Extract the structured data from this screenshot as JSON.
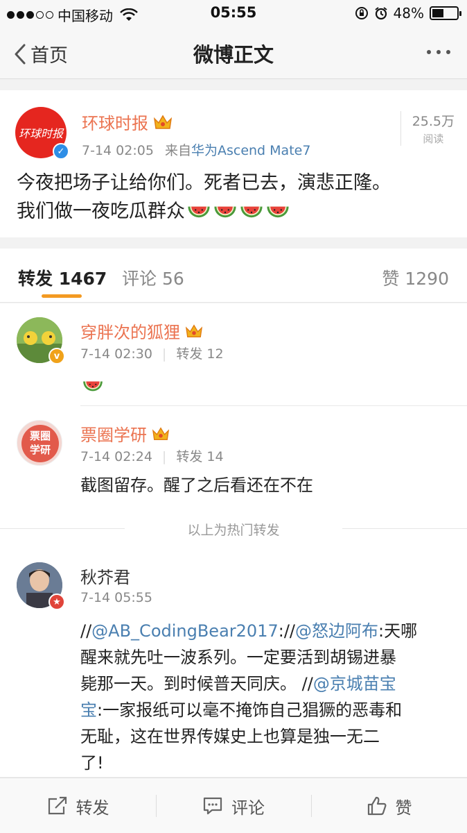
{
  "status": {
    "carrier": "中国移动",
    "time": "05:55",
    "battery": "48%",
    "battery_level": 0.48
  },
  "nav": {
    "back_label": "首页",
    "title": "微博正文"
  },
  "post": {
    "avatar_text": "环球时报",
    "author": "环球时报",
    "time": "7-14 02:05",
    "source_prefix": "来自",
    "source": "华为Ascend Mate7",
    "reads_num": "25.5万",
    "reads_label": "阅读",
    "body_line1": "今夜把场子让给你们。死者已去，演悲正隆。",
    "body_line2": "我们做一夜吃瓜群众"
  },
  "tabs": {
    "repost": "转发 1467",
    "comment": "评论 56",
    "like": "赞 1290"
  },
  "reposts": [
    {
      "name": "穿胖次的狐狸",
      "time": "7-14 02:30",
      "count": "转发 12"
    },
    {
      "name": "票圈学研",
      "avatar_text": "票圈学研",
      "time": "7-14 02:24",
      "count": "转发 14",
      "text": "截图留存。醒了之后看还在不在"
    }
  ],
  "hot_label": "以上为热门转发",
  "latest": {
    "name": "秋芥君",
    "time": "7-14 05:55",
    "t1": "//",
    "m1": "@AB_CodingBear2017",
    "t2": "://",
    "m2": "@怒边阿布",
    "t3": ":天哪",
    "line2": "醒来就先吐一波系列。一定要活到胡锡进暴",
    "t4": "毙那一天。到时候普天同庆。 //",
    "m3": "@京城苗宝",
    "m3b": "宝",
    "t5": ":一家报纸可以毫不掩饰自己猖獗的恶毒和",
    "line5": "无耻，这在世界传媒史上也算是独一无二",
    "line6": "了!"
  },
  "toolbar": {
    "repost": "转发",
    "comment": "评论",
    "like": "赞"
  },
  "colors": {
    "accent": "#eb7350",
    "link": "#4a7fb0",
    "tab_underline": "#f39a22",
    "brand_red": "#e5261f"
  }
}
